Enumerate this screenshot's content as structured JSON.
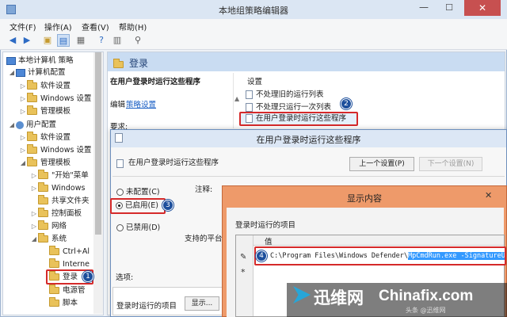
{
  "window": {
    "title": "本地组策略编辑器"
  },
  "menu": [
    "文件(F)",
    "操作(A)",
    "查看(V)",
    "帮助(H)"
  ],
  "tree": {
    "root": "本地计算机 策略",
    "computer_config": "计算机配置",
    "c_items": [
      "软件设置",
      "Windows 设置",
      "管理模板"
    ],
    "user_config": "用户配置",
    "u_items": [
      "软件设置",
      "Windows 设置",
      "管理模板"
    ],
    "admin_items": [
      "\"开始\"菜单",
      "Windows",
      "共享文件夹",
      "控制面板",
      "网络",
      "系统"
    ],
    "system_items": [
      "Ctrl+Al",
      "Interne",
      "登录",
      "电源管",
      "脚本"
    ]
  },
  "detail": {
    "folder_title": "登录",
    "policy_title": "在用户登录时运行这些程序",
    "edit_prefix": "编辑",
    "edit_link": "策略设置",
    "req_label": "要求:",
    "settings_header": "设置",
    "settings": [
      "不处理旧的运行列表",
      "不处理只运行一次列表",
      "在用户登录时运行这些程序"
    ]
  },
  "policy_dialog": {
    "title": "在用户登录时运行这些程序",
    "header_name": "在用户登录时运行这些程序",
    "prev_button": "上一个设置(P)",
    "next_button": "下一个设置(N)",
    "options": [
      "未配置(C)",
      "已启用(E)",
      "已禁用(D)"
    ],
    "comment_label": "注释:",
    "platform_label": "支持的平台:",
    "options_label": "选项:",
    "list_label": "登录时运行的项目",
    "show_button": "显示..."
  },
  "show_dialog": {
    "title": "显示内容",
    "list_label": "登录时运行的项目",
    "column": "值",
    "value_prefix": "C:\\Program Files\\Windows Defender\\",
    "value_selected": "MpCmdRun.exe -SignatureUpdate",
    "new_row": "*"
  },
  "badges": [
    "1",
    "2",
    "3",
    "4"
  ],
  "watermark": {
    "site1": "迅维网",
    "site2": "Chinafix.com",
    "small": "头条 @迅维网"
  },
  "colors": {
    "accent": "#2d6bc4",
    "highlight_red": "#d52a2a",
    "selection": "#3399ff"
  }
}
